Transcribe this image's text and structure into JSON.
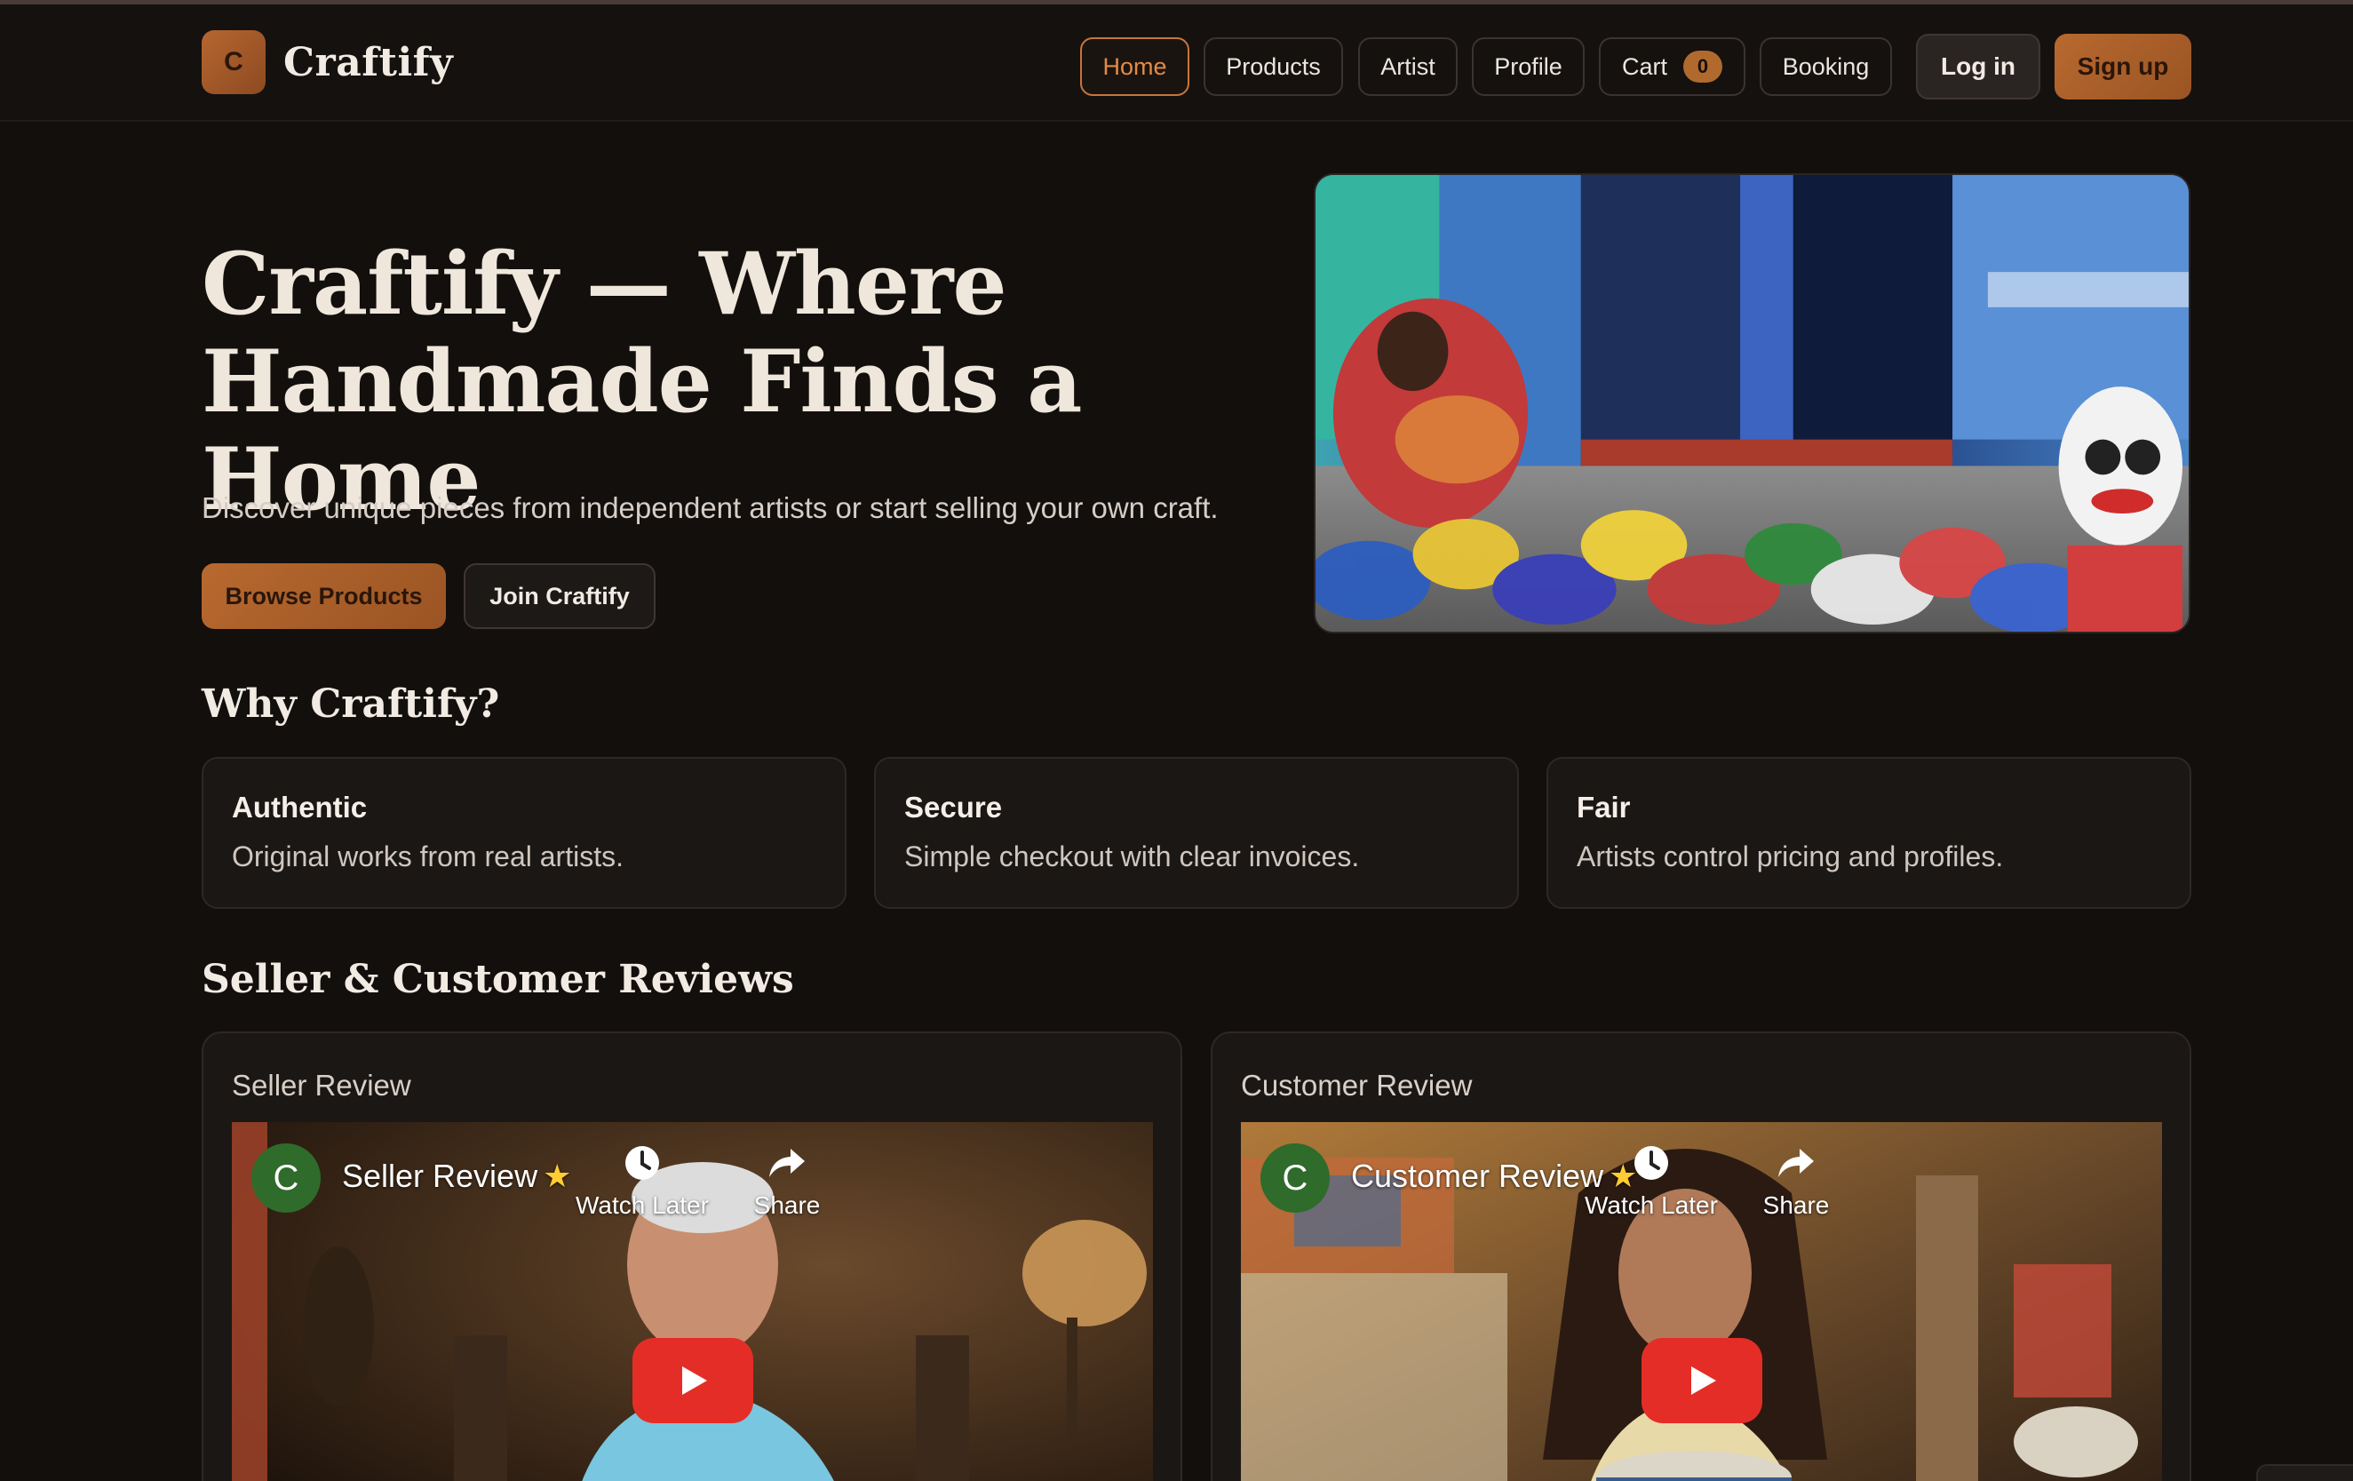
{
  "brand": {
    "logo_letter": "C",
    "name": "Craftify"
  },
  "nav": {
    "items": [
      {
        "label": "Home",
        "active": true
      },
      {
        "label": "Products"
      },
      {
        "label": "Artist"
      },
      {
        "label": "Profile"
      },
      {
        "label": "Cart",
        "badge": "0"
      },
      {
        "label": "Booking"
      }
    ],
    "login_label": "Log in",
    "signup_label": "Sign up"
  },
  "hero": {
    "title_line1": "Craftify — Where",
    "title_line2": "Handmade Finds a Home",
    "subtitle": "Discover unique pieces from independent artists or start selling your own craft.",
    "browse_label": "Browse Products",
    "join_label": "Join Craftify"
  },
  "why": {
    "title": "Why Craftify?",
    "features": [
      {
        "title": "Authentic",
        "desc": "Original works from real artists."
      },
      {
        "title": "Secure",
        "desc": "Simple checkout with clear invoices."
      },
      {
        "title": "Fair",
        "desc": "Artists control pricing and profiles."
      }
    ]
  },
  "reviews": {
    "title": "Seller & Customer Reviews",
    "cards": [
      {
        "label": "Seller Review",
        "channel_letter": "C",
        "video_title": "Seller Review",
        "watch_later": "Watch Later",
        "share": "Share"
      },
      {
        "label": "Customer Review",
        "channel_letter": "C",
        "video_title": "Customer Review",
        "watch_later": "Watch Later",
        "share": "Share"
      }
    ]
  },
  "colors": {
    "background": "#120f0d",
    "accent": "#b8692f",
    "active_nav": "#e58a46",
    "play_button": "#e52d27"
  },
  "icons": [
    "clock-icon",
    "share-arrow-icon",
    "play-icon",
    "star-icon"
  ]
}
